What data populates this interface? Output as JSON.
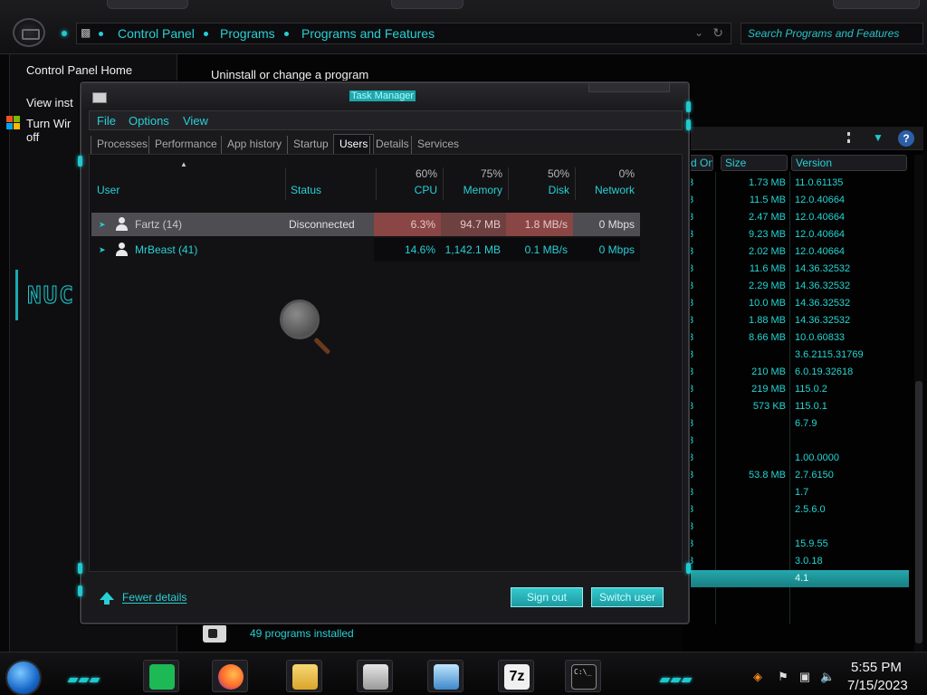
{
  "explorer": {
    "breadcrumbs": [
      "Control Panel",
      "Programs",
      "Programs and Features"
    ],
    "search_placeholder": "Search Programs and Features",
    "left_pane": {
      "home": "Control Panel Home",
      "view_installed": "View inst",
      "turn_windows_line1": "Turn Wir",
      "turn_windows_line2": "off"
    },
    "heading": "Uninstall or change a program",
    "columns": [
      "d On",
      "Size",
      "Version"
    ],
    "programs": [
      {
        "on": "3",
        "size": "1.73 MB",
        "version": "11.0.61135"
      },
      {
        "on": "3",
        "size": "11.5 MB",
        "version": "12.0.40664"
      },
      {
        "on": "3",
        "size": "2.47 MB",
        "version": "12.0.40664"
      },
      {
        "on": "3",
        "size": "9.23 MB",
        "version": "12.0.40664"
      },
      {
        "on": "3",
        "size": "2.02 MB",
        "version": "12.0.40664"
      },
      {
        "on": "3",
        "size": "11.6 MB",
        "version": "14.36.32532"
      },
      {
        "on": "3",
        "size": "2.29 MB",
        "version": "14.36.32532"
      },
      {
        "on": "3",
        "size": "10.0 MB",
        "version": "14.36.32532"
      },
      {
        "on": "3",
        "size": "1.88 MB",
        "version": "14.36.32532"
      },
      {
        "on": "3",
        "size": "8.66 MB",
        "version": "10.0.60833"
      },
      {
        "on": "3",
        "size": "",
        "version": "3.6.2115.31769"
      },
      {
        "on": "3",
        "size": "210 MB",
        "version": "6.0.19.32618"
      },
      {
        "on": "3",
        "size": "219 MB",
        "version": "115.0.2"
      },
      {
        "on": "3",
        "size": "573 KB",
        "version": "115.0.1"
      },
      {
        "on": "3",
        "size": "",
        "version": "6.7.9"
      },
      {
        "on": "3",
        "size": "",
        "version": ""
      },
      {
        "on": "3",
        "size": "",
        "version": "1.00.0000"
      },
      {
        "on": "3",
        "size": "53.8 MB",
        "version": "2.7.6150"
      },
      {
        "on": "3",
        "size": "",
        "version": "1.7"
      },
      {
        "on": "3",
        "size": "",
        "version": "2.5.6.0"
      },
      {
        "on": "3",
        "size": "",
        "version": ""
      },
      {
        "on": "3",
        "size": "",
        "version": "15.9.55"
      },
      {
        "on": "3",
        "size": "",
        "version": "3.0.18"
      },
      {
        "on": "",
        "size": "",
        "version": "4.1"
      }
    ],
    "status_text": "49 programs installed"
  },
  "task_manager": {
    "title": "Task Manager",
    "menu": [
      "File",
      "Options",
      "View"
    ],
    "tabs": [
      "Processes",
      "Performance",
      "App history",
      "Startup",
      "Users",
      "Details",
      "Services"
    ],
    "active_tab": "Users",
    "headers": {
      "user": "User",
      "status": "Status",
      "cpu": {
        "pct": "60%",
        "label": "CPU"
      },
      "memory": {
        "pct": "75%",
        "label": "Memory"
      },
      "disk": {
        "pct": "50%",
        "label": "Disk"
      },
      "network": {
        "pct": "0%",
        "label": "Network"
      }
    },
    "users": [
      {
        "name": "Fartz (14)",
        "status": "Disconnected",
        "cpu": "6.3%",
        "memory": "94.7 MB",
        "disk": "1.8 MB/s",
        "network": "0 Mbps"
      },
      {
        "name": "MrBeast (41)",
        "status": "",
        "cpu": "14.6%",
        "memory": "1,142.1 MB",
        "disk": "0.1 MB/s",
        "network": "0 Mbps"
      }
    ],
    "fewer_details": "Fewer details",
    "sign_out": "Sign out",
    "switch_user": "Switch user"
  },
  "taskbar": {
    "apps": [
      "spotify-icon",
      "firefox-icon",
      "file-explorer-icon",
      "task-manager-icon",
      "control-panel-icon",
      "7zip-icon",
      "cmd-icon"
    ],
    "labels": {
      "sevenzip": "7z",
      "cmd": "C:\\_"
    },
    "time": "5:55 PM",
    "date": "7/15/2023"
  }
}
